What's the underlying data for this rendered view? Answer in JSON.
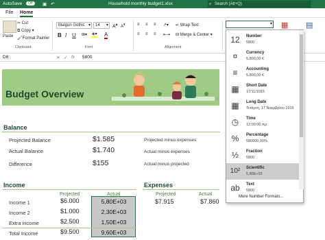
{
  "titlebar": {
    "autosave": "AutoSave",
    "autosave_state": "Off",
    "doc": "Household monthly budget1.xlsx",
    "search": "Search (Alt+Q)"
  },
  "menu": {
    "file": "File",
    "home": "Home"
  },
  "ribbon": {
    "paste": "Paste",
    "cut": "Cut",
    "copy": "Copy",
    "format_painter": "Format Painter",
    "font_name": "Malgun Gothic",
    "font_size": "14",
    "bold": "B",
    "italic": "I",
    "underline": "U",
    "wrap_text": "Wrap Text",
    "merge_center": "Merge & Center",
    "clipboard": "Clipboard",
    "font": "Font",
    "alignment": "Alignment"
  },
  "formula_bar": {
    "cell_ref": "D8",
    "value": "5800"
  },
  "sheet": {
    "banner_title": "Budget Overview",
    "balance_title": "Balance",
    "balance_rows": [
      {
        "label": "Projected Balance",
        "value": "$1.585",
        "desc": "Projected minus expenses"
      },
      {
        "label": "Actual Balance",
        "value": "$1.740",
        "desc": "Actual minus expenses"
      },
      {
        "label": "Difference",
        "value": "$155",
        "desc": "Actual minus projected"
      }
    ],
    "income_title": "Income",
    "col_projected": "Projected",
    "col_actual": "Actual",
    "income_rows": [
      {
        "label": "Income 1",
        "projected": "$6.000",
        "actual": "5,80E+03"
      },
      {
        "label": "Income 2",
        "projected": "$1.000",
        "actual": "2,30E+03"
      },
      {
        "label": "Extra income",
        "projected": "$2.500",
        "actual": "1,50E+03"
      },
      {
        "label": "Total Income",
        "projected": "$9.500",
        "actual": "9,60E+03"
      }
    ],
    "expenses_title": "Expenses",
    "exp_projected": "$7.915",
    "exp_actual": "$7.860"
  },
  "formats": [
    {
      "icon": "12",
      "name": "Number",
      "example": "5800"
    },
    {
      "icon": "¤",
      "name": "Currency",
      "example": "5.800,00 €"
    },
    {
      "icon": "≡",
      "name": "Accounting",
      "example": "5.800,00 €"
    },
    {
      "icon": "▦",
      "name": "Short Date",
      "example": "17/11/1915"
    },
    {
      "icon": "▦",
      "name": "Long Date",
      "example": "Τετάρτη, 17 Νοεμβρίου 1915"
    },
    {
      "icon": "◷",
      "name": "Time",
      "example": "12:00:00 πμ"
    },
    {
      "icon": "%",
      "name": "Percentage",
      "example": "580000,00%"
    },
    {
      "icon": "½",
      "name": "Fraction",
      "example": "5800"
    },
    {
      "icon": "10²",
      "name": "Scientific",
      "example": "5,80E+03"
    },
    {
      "icon": "ab",
      "name": "Text",
      "example": "5800"
    }
  ],
  "more_formats": "More Number Formats..."
}
